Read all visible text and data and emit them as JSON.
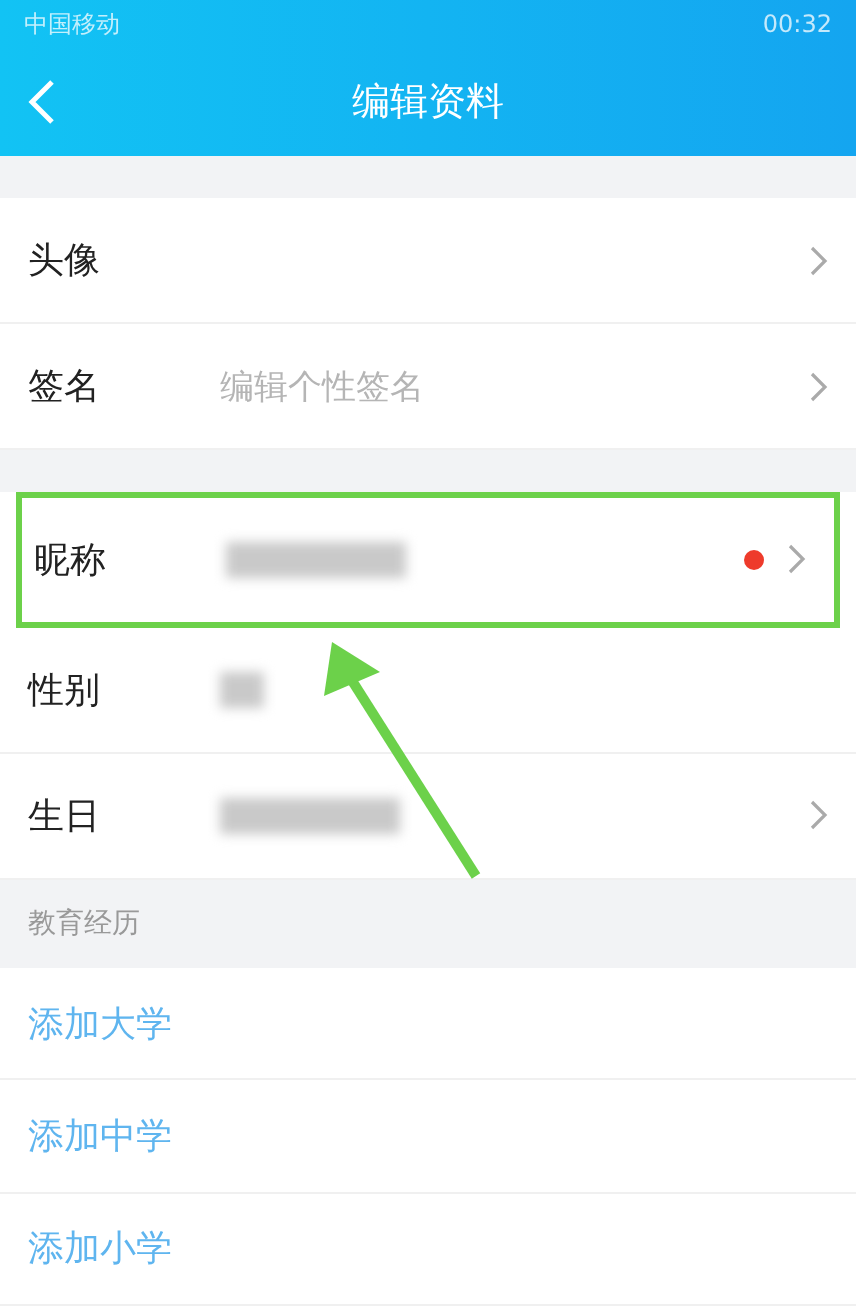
{
  "status_bar": {
    "carrier": "中国移动",
    "time": "00:32"
  },
  "header": {
    "title": "编辑资料"
  },
  "groups": [
    {
      "rows": [
        {
          "label": "头像",
          "kind": "link",
          "highlighted": false,
          "badge_dot": false
        },
        {
          "label": "签名",
          "placeholder": "编辑个性签名",
          "kind": "link",
          "highlighted": false,
          "badge_dot": false
        }
      ]
    },
    {
      "rows": [
        {
          "label": "昵称",
          "kind": "link",
          "value_redacted": true,
          "highlighted": true,
          "badge_dot": true
        },
        {
          "label": "性别",
          "kind": "plain",
          "value_redacted": true,
          "highlighted": false,
          "badge_dot": false
        },
        {
          "label": "生日",
          "kind": "link",
          "value_redacted": true,
          "highlighted": false,
          "badge_dot": false
        }
      ]
    }
  ],
  "education": {
    "heading": "教育经历",
    "actions": [
      "添加大学",
      "添加中学",
      "添加小学"
    ]
  },
  "annotation": {
    "arrow": true
  }
}
